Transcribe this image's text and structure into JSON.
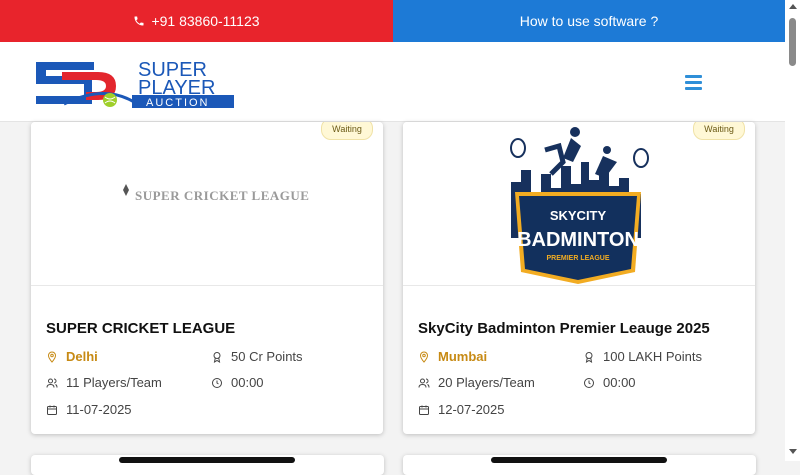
{
  "topbar": {
    "phone": "+91 83860-11123",
    "howto": "How to use software ?"
  },
  "logo": {
    "line1": "SUPER",
    "line2": "PLAYER",
    "line3": "AUCTION"
  },
  "cards": [
    {
      "status": "Waiting",
      "image_text": "SUPER CRICKET LEAGUE",
      "title": "SUPER CRICKET LEAGUE",
      "city": "Delhi",
      "points": "50 Cr Points",
      "players": "11 Players/Team",
      "time": "00:00",
      "date": "11-07-2025"
    },
    {
      "status": "Waiting",
      "image_text": {
        "top": "SKYCITY",
        "main": "BADMINTON",
        "sub": "PREMIER LEAGUE"
      },
      "title": "SkyCity Badminton Premier Leauge 2025",
      "city": "Mumbai",
      "points": "100 LAKH Points",
      "players": "20 Players/Team",
      "time": "00:00",
      "date": "12-07-2025"
    }
  ],
  "colors": {
    "phone_bar": "#e8242c",
    "howto_bar": "#1d7ad6",
    "city": "#c78a14",
    "logo_blue": "#1b58b8",
    "logo_red": "#e3262d"
  },
  "icons": [
    "phone-icon",
    "menu-icon",
    "location-pin-icon",
    "award-icon",
    "users-icon",
    "clock-icon",
    "calendar-icon"
  ]
}
